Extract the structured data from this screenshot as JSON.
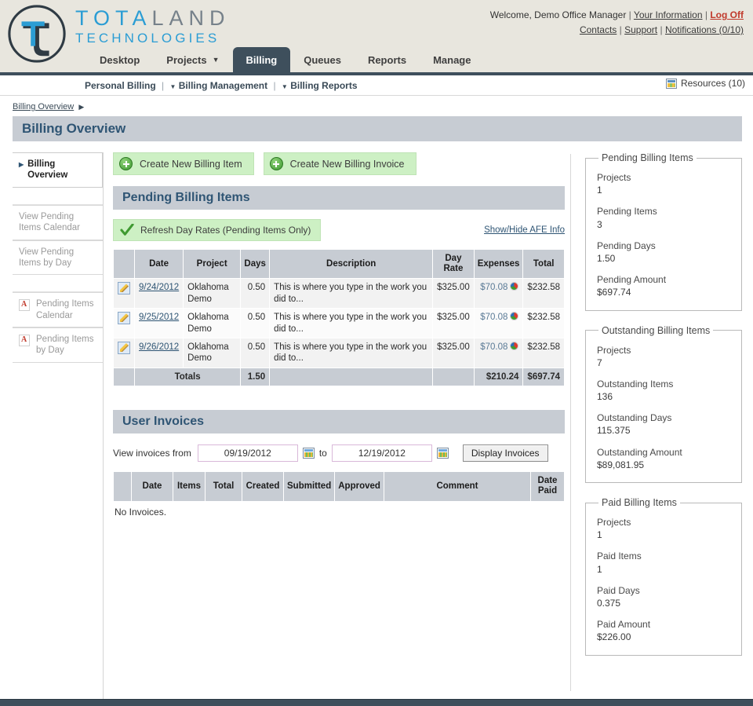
{
  "brand": {
    "name_line1_a": "TOTA",
    "name_line1_b": "LAND",
    "name_line2": "TECHNOLOGIES",
    "logo_icon": "totaland-tl-monogram-icon",
    "accent_blue": "#2b9dd4",
    "accent_gray": "#76818a",
    "header_bg": "#e8e6de",
    "navbar_dark": "#3e4f5c"
  },
  "header": {
    "welcome_text": "Welcome, Demo Office Manager",
    "your_information": "Your Information",
    "log_off": "Log Off",
    "contacts": "Contacts",
    "support": "Support",
    "notifications": "Notifications (0/10)",
    "separator": "|"
  },
  "nav": {
    "tabs": [
      {
        "label": "Desktop",
        "active": false,
        "has_caret": false
      },
      {
        "label": "Projects",
        "active": false,
        "has_caret": true
      },
      {
        "label": "Billing",
        "active": true,
        "has_caret": false
      },
      {
        "label": "Queues",
        "active": false,
        "has_caret": false
      },
      {
        "label": "Reports",
        "active": false,
        "has_caret": false
      },
      {
        "label": "Manage",
        "active": false,
        "has_caret": false
      }
    ],
    "caret_glyph": "▼"
  },
  "subnav": {
    "items": [
      {
        "label": "Personal Billing",
        "has_caret": false
      },
      {
        "label": "Billing Management",
        "has_caret": true
      },
      {
        "label": "Billing Reports",
        "has_caret": true
      }
    ],
    "separator": "|",
    "caret_glyph": "▼",
    "resources_label": "Resources (10)",
    "resources_icon": "grid-table-icon"
  },
  "breadcrumb": {
    "label": "Billing Overview",
    "arrow_glyph": "▶"
  },
  "page_title": "Billing Overview",
  "sidebar": {
    "items": [
      {
        "label": "Billing Overview",
        "active": true,
        "icon": "triangle-right-icon"
      },
      {
        "label": "View Pending Items Calendar",
        "active": false,
        "icon": null
      },
      {
        "label": "View Pending Items by Day",
        "active": false,
        "icon": null
      },
      {
        "label": "Pending Items Calendar",
        "active": false,
        "icon": "pdf-icon"
      },
      {
        "label": "Pending Items by Day",
        "active": false,
        "icon": "pdf-icon"
      }
    ]
  },
  "actions": {
    "create_billing_item": "Create New Billing Item",
    "create_billing_invoice": "Create New Billing Invoice",
    "plus_icon": "green-plus-circle-icon"
  },
  "pending": {
    "section_title": "Pending Billing Items",
    "refresh_label": "Refresh Day Rates (Pending Items Only)",
    "refresh_icon": "green-check-icon",
    "afe_link": "Show/Hide AFE Info",
    "columns": [
      "",
      "Date",
      "Project",
      "Days",
      "Description",
      "Day Rate",
      "Expenses",
      "Total"
    ],
    "rows": [
      {
        "edit_icon": "edit-pencil-icon",
        "date": "9/24/2012",
        "project": "Oklahoma Demo",
        "days": "0.50",
        "description": "This is where you type in the work you did to...",
        "day_rate": "$325.00",
        "expenses": "$70.08",
        "expenses_icon": "pie-chart-icon",
        "total": "$232.58"
      },
      {
        "edit_icon": "edit-pencil-icon",
        "date": "9/25/2012",
        "project": "Oklahoma Demo",
        "days": "0.50",
        "description": "This is where you type in the work you did to...",
        "day_rate": "$325.00",
        "expenses": "$70.08",
        "expenses_icon": "pie-chart-icon",
        "total": "$232.58"
      },
      {
        "edit_icon": "edit-pencil-icon",
        "date": "9/26/2012",
        "project": "Oklahoma Demo",
        "days": "0.50",
        "description": "This is where you type in the work you did to...",
        "day_rate": "$325.00",
        "expenses": "$70.08",
        "expenses_icon": "pie-chart-icon",
        "total": "$232.58"
      }
    ],
    "totals": {
      "label": "Totals",
      "days": "1.50",
      "expenses": "$210.24",
      "total": "$697.74"
    }
  },
  "invoices": {
    "section_title": "User Invoices",
    "filter_label": "View invoices from",
    "from_value": "09/19/2012",
    "to_label": "to",
    "to_value": "12/19/2012",
    "calendar_icon": "calendar-picker-icon",
    "display_button": "Display Invoices",
    "columns": [
      "",
      "Date",
      "Items",
      "Total",
      "Created",
      "Submitted",
      "Approved",
      "Comment",
      "Date Paid"
    ],
    "empty_message": "No Invoices."
  },
  "panels": [
    {
      "title": "Pending Billing Items",
      "stats": [
        {
          "key": "Projects",
          "value": "1"
        },
        {
          "key": "Pending Items",
          "value": "3"
        },
        {
          "key": "Pending Days",
          "value": "1.50"
        },
        {
          "key": "Pending Amount",
          "value": "$697.74"
        }
      ]
    },
    {
      "title": "Outstanding Billing Items",
      "stats": [
        {
          "key": "Projects",
          "value": "7"
        },
        {
          "key": "Outstanding Items",
          "value": "136"
        },
        {
          "key": "Outstanding Days",
          "value": "115.375"
        },
        {
          "key": "Outstanding Amount",
          "value": "$89,081.95"
        }
      ]
    },
    {
      "title": "Paid Billing Items",
      "stats": [
        {
          "key": "Projects",
          "value": "1"
        },
        {
          "key": "Paid Items",
          "value": "1"
        },
        {
          "key": "Paid Days",
          "value": "0.375"
        },
        {
          "key": "Paid Amount",
          "value": "$226.00"
        }
      ]
    }
  ]
}
